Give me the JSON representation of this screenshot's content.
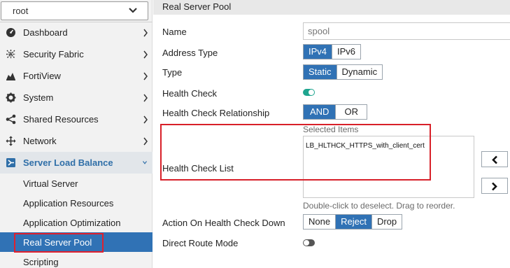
{
  "sidebar": {
    "vdom_value": "root",
    "items": [
      {
        "label": "Dashboard",
        "icon": "dashboard-icon"
      },
      {
        "label": "Security Fabric",
        "icon": "security-fabric-icon"
      },
      {
        "label": "FortiView",
        "icon": "fortiview-icon"
      },
      {
        "label": "System",
        "icon": "gear-icon"
      },
      {
        "label": "Shared Resources",
        "icon": "share-icon"
      },
      {
        "label": "Network",
        "icon": "network-icon"
      },
      {
        "label": "Server Load Balance",
        "icon": "load-balance-icon"
      }
    ],
    "subitems": [
      {
        "label": "Virtual Server"
      },
      {
        "label": "Application Resources"
      },
      {
        "label": "Application Optimization"
      },
      {
        "label": "Real Server Pool"
      },
      {
        "label": "Scripting"
      }
    ]
  },
  "main": {
    "section_title": "Real Server Pool",
    "name": {
      "label": "Name",
      "placeholder": "spool"
    },
    "address_type": {
      "label": "Address Type",
      "options": [
        "IPv4",
        "IPv6"
      ],
      "selected": "IPv4"
    },
    "type": {
      "label": "Type",
      "options": [
        "Static",
        "Dynamic"
      ],
      "selected": "Static"
    },
    "health_check": {
      "label": "Health Check",
      "enabled": true
    },
    "health_check_relationship": {
      "label": "Health Check Relationship",
      "options": [
        "AND",
        "OR"
      ],
      "selected": "AND"
    },
    "health_check_list": {
      "label": "Health Check List",
      "selected_caption": "Selected Items",
      "items": [
        "LB_HLTHCK_HTTPS_with_client_cert"
      ],
      "hint": "Double-click to deselect. Drag to reorder."
    },
    "action_on_health_check_down": {
      "label": "Action On Health Check Down",
      "options": [
        "None",
        "Reject",
        "Drop"
      ],
      "selected": "Reject"
    },
    "direct_route_mode": {
      "label": "Direct Route Mode",
      "enabled": false
    }
  },
  "colors": {
    "accent": "#3072b5",
    "toggle_on": "#1fa58f",
    "highlight_red": "#d82029"
  }
}
